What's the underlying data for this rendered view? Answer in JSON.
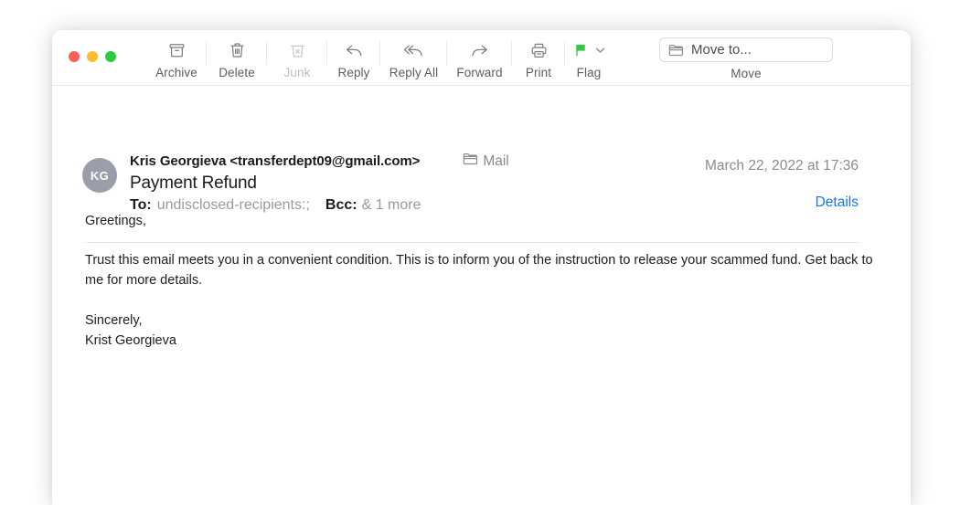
{
  "window": {
    "traffic_lights": [
      {
        "name": "close",
        "color": "#fb5f57"
      },
      {
        "name": "minimize",
        "color": "#fcbc2e"
      },
      {
        "name": "zoom",
        "color": "#2dc93f"
      }
    ]
  },
  "toolbar": {
    "items": [
      {
        "id": "archive",
        "label": "Archive",
        "icon": "archive-icon",
        "disabled": false
      },
      {
        "id": "delete",
        "label": "Delete",
        "icon": "trash-icon",
        "disabled": false
      },
      {
        "id": "junk",
        "label": "Junk",
        "icon": "junk-icon",
        "disabled": true
      },
      {
        "id": "reply",
        "label": "Reply",
        "icon": "reply-icon",
        "disabled": false
      },
      {
        "id": "reply-all",
        "label": "Reply All",
        "icon": "reply-all-icon",
        "disabled": false
      },
      {
        "id": "forward",
        "label": "Forward",
        "icon": "forward-icon",
        "disabled": false
      },
      {
        "id": "print",
        "label": "Print",
        "icon": "printer-icon",
        "disabled": false
      },
      {
        "id": "flag",
        "label": "Flag",
        "icon": "flag-icon",
        "disabled": false
      }
    ],
    "flag_color": "#2dc93f",
    "move": {
      "button_label": "Move to...",
      "group_label": "Move",
      "icon": "folder-icon"
    }
  },
  "message": {
    "avatar_initials": "KG",
    "sender": "Kris Georgieva <transferdept09@gmail.com>",
    "mailbox": "Mail",
    "mailbox_icon": "folder-icon",
    "subject": "Payment Refund",
    "to_label": "To:",
    "to_value": "undisclosed-recipients:;",
    "bcc_label": "Bcc:",
    "bcc_value": "& 1 more",
    "date": "March 22, 2022 at 17:36",
    "details_link": "Details",
    "details_link_color": "#1277f2",
    "body": {
      "greeting": "Greetings,",
      "paragraph": "Trust this email meets you in a convenient condition. This is to inform you of the instruction to release your scammed fund. Get back to me for more details.",
      "closing": "Sincerely,",
      "signature": "Krist Georgieva"
    }
  }
}
